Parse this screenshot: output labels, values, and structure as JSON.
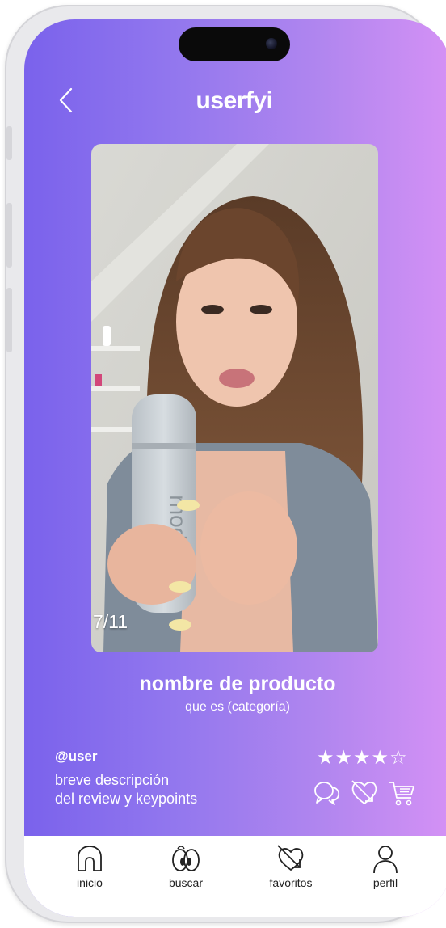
{
  "app": {
    "brand": "userfyi"
  },
  "media": {
    "counter": "7/11"
  },
  "product": {
    "name": "nombre de producto",
    "category": "que es (categoría)"
  },
  "review": {
    "user": "@user",
    "description_line1": "breve descripción",
    "description_line2": "del review y keypoints",
    "rating": 4,
    "rating_max": 5
  },
  "tabs": [
    {
      "label": "inicio",
      "icon": "home-icon"
    },
    {
      "label": "buscar",
      "icon": "eyes-icon"
    },
    {
      "label": "favoritos",
      "icon": "heart-arrow-icon"
    },
    {
      "label": "perfil",
      "icon": "user-icon"
    }
  ],
  "colors": {
    "gradient_start": "#7a62ec",
    "gradient_end": "#d491f5",
    "text": "#ffffff",
    "tabbar": "#ffffff"
  }
}
